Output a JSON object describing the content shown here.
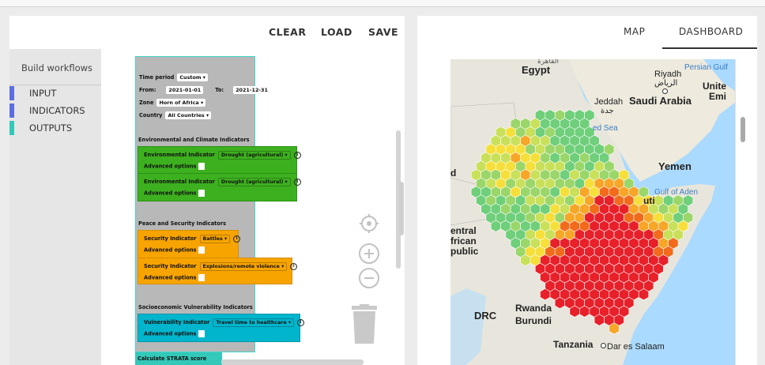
{
  "left": {
    "toolbar": {
      "clear": "CLEAR",
      "load": "LOAD",
      "save": "SAVE"
    },
    "sidebar": {
      "title": "Build workflows",
      "items": [
        {
          "label": "INPUT",
          "color": "#5b6ee1"
        },
        {
          "label": "INDICATORS",
          "color": "#5b6ee1"
        },
        {
          "label": "OUTPUTS",
          "color": "#33c8b8"
        }
      ]
    },
    "workflow": {
      "time_period_label": "Time period",
      "time_period_value": "Custom ▾",
      "from_label": "From:",
      "from_value": "2021-01-01",
      "to_label": "To:",
      "to_value": "2021-12-31",
      "zone_label": "Zone",
      "zone_value": "Horn of Africa ▾",
      "country_label": "Country",
      "country_value": "All Countries ▾",
      "env_group": "Environmental and Climate Indicators",
      "env_blocks": [
        {
          "label": "Environmental Indicator",
          "value": "Drought (agricultural) ▾",
          "advanced": "Advanced options"
        },
        {
          "label": "Environmental Indicator",
          "value": "Drought (agricultural) ▾",
          "advanced": "Advanced options"
        }
      ],
      "sec_group": "Peace and Security Indicators",
      "sec_blocks": [
        {
          "label": "Security Indicator",
          "value": "Battles ▾",
          "advanced": "Advanced options"
        },
        {
          "label": "Security Indicator",
          "value": "Explosions/remote violence ▾",
          "advanced": "Advanced options"
        }
      ],
      "soc_group": "Socioeconomic Vulnerability Indicators",
      "soc_blocks": [
        {
          "label": "Vulnerability Indicator",
          "value": "Travel time to healthcare ▾",
          "advanced": "Advanced options"
        }
      ],
      "calc_label": "Calculate STRATA score"
    },
    "controls": [
      "target-icon",
      "zoom-in-icon",
      "zoom-out-icon",
      "trash-icon"
    ]
  },
  "right": {
    "tabs": [
      {
        "label": "MAP",
        "active": false
      },
      {
        "label": "DASHBOARD",
        "active": true
      }
    ],
    "map_labels": {
      "egypt": "Egypt",
      "riyadh": "Riyadh",
      "riyadh_ar": "الرياض",
      "persian_gulf": "Persian Gulf",
      "united": "Unite",
      "emi": "Emi",
      "jeddah": "Jeddah",
      "jeddah_ar": "جدة",
      "saudi": "Saudi Arabia",
      "red_sea": "ed Sea",
      "yemen": "Yemen",
      "gulf_aden": "Gulf of Aden",
      "uti": "uti",
      "d": "d",
      "central1": "entral",
      "central2": "frican",
      "central3": "public",
      "drc": "DRC",
      "rwanda": "Rwanda",
      "burundi": "Burundi",
      "tanzania": "Tanzania",
      "dar": "Dar es Salaam",
      "top_ar": "القاهرة"
    }
  }
}
